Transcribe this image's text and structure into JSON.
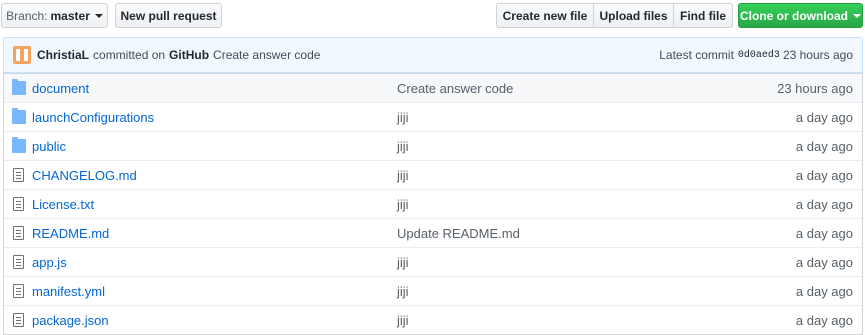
{
  "toolbar": {
    "branch_prefix": "Branch:",
    "branch_name": "master",
    "new_pull_request": "New pull request",
    "create_new_file": "Create new file",
    "upload_files": "Upload files",
    "find_file": "Find file",
    "clone_or_download": "Clone or download"
  },
  "commit": {
    "author": "ChristiaL",
    "via_label": "committed on",
    "via": "GitHub",
    "message": "Create answer code",
    "latest_label": "Latest commit",
    "sha": "0d0aed3",
    "age": "23 hours ago"
  },
  "files": [
    {
      "type": "folder",
      "name": "document",
      "message": "Create answer code",
      "age": "23 hours ago"
    },
    {
      "type": "folder",
      "name": "launchConfigurations",
      "message": "jiji",
      "age": "a day ago"
    },
    {
      "type": "folder",
      "name": "public",
      "message": "jiji",
      "age": "a day ago"
    },
    {
      "type": "file",
      "name": "CHANGELOG.md",
      "message": "jiji",
      "age": "a day ago"
    },
    {
      "type": "file",
      "name": "License.txt",
      "message": "jiji",
      "age": "a day ago"
    },
    {
      "type": "file",
      "name": "README.md",
      "message": "Update README.md",
      "age": "a day ago"
    },
    {
      "type": "file",
      "name": "app.js",
      "message": "jiji",
      "age": "a day ago"
    },
    {
      "type": "file",
      "name": "manifest.yml",
      "message": "jiji",
      "age": "a day ago"
    },
    {
      "type": "file",
      "name": "package.json",
      "message": "jiji",
      "age": "a day ago"
    }
  ],
  "colors": {
    "link": "#0366d6",
    "clone_button": "#28a745",
    "commit_bar_bg": "#f1f8ff",
    "folder_icon": "#79b8ff"
  }
}
